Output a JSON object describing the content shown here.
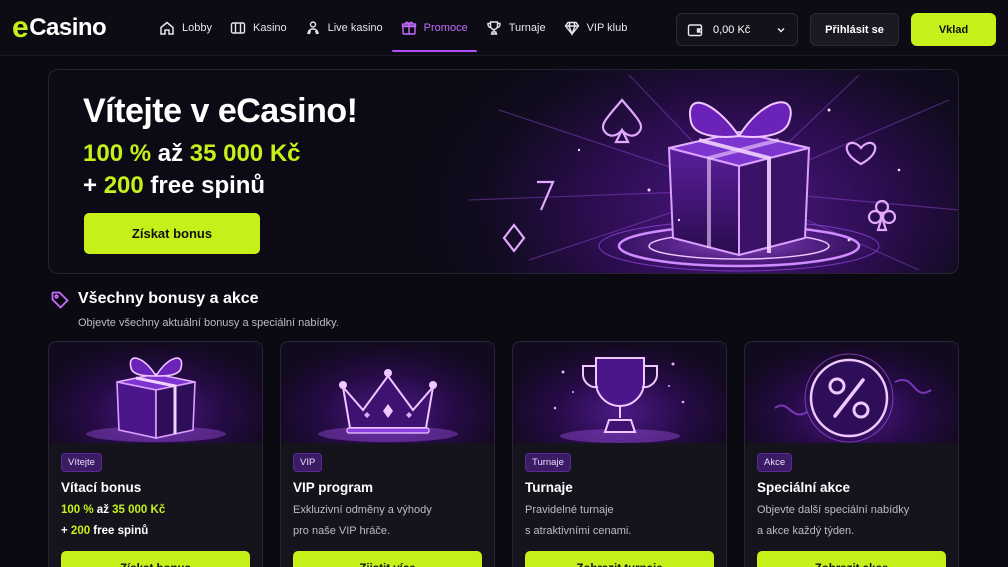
{
  "brand": {
    "e": "e",
    "rest": "Casino"
  },
  "nav": {
    "items": [
      {
        "label": "Lobby",
        "icon": "home-icon"
      },
      {
        "label": "Kasino",
        "icon": "casino-icon"
      },
      {
        "label": "Live kasino",
        "icon": "live-dealer-icon"
      },
      {
        "label": "Promoce",
        "icon": "gift-icon",
        "active": true
      },
      {
        "label": "Turnaje",
        "icon": "trophy-icon"
      },
      {
        "label": "VIP klub",
        "icon": "diamond-icon"
      }
    ]
  },
  "wallet": {
    "balance": "0,00 Kč"
  },
  "header": {
    "login_label": "Přihlásit se",
    "deposit_label": "Vklad"
  },
  "hero": {
    "title": "Vítejte v eCasino!",
    "line1": {
      "amount": "100 %",
      "mid": " až ",
      "max": "35 000 Kč"
    },
    "line2": {
      "prefix": "+ ",
      "spins": "200",
      "suffix": " free spinů"
    },
    "cta": "Získat bonus"
  },
  "section": {
    "title": "Všechny bonusy a akce",
    "subtitle": "Objevte všechny aktuální bonusy a speciální nabídky."
  },
  "cards": [
    {
      "badge": "Vítejte",
      "title": "Vítací bonus",
      "line1": {
        "amount": "100 %",
        "mid": " až ",
        "max": "35 000 Kč"
      },
      "line2": {
        "prefix": "+ ",
        "spins": "200",
        "suffix": " free spinů"
      },
      "button": "Získat bonus",
      "art": "gift-icon"
    },
    {
      "badge": "VIP",
      "title": "VIP program",
      "text1": "Exkluzivní odměny a výhody",
      "text2": "pro naše VIP hráče.",
      "button": "Zjistit více",
      "art": "crown-icon"
    },
    {
      "badge": "Turnaje",
      "title": "Turnaje",
      "text1": "Pravidelné turnaje",
      "text2": "s atraktivními cenami.",
      "button": "Zobrazit turnaje",
      "art": "trophy-icon"
    },
    {
      "badge": "Akce",
      "title": "Speciální akce",
      "text1": "Objevte další speciální nabídky",
      "text2": "a akce každý týden.",
      "button": "Zobrazit akce",
      "art": "percent-icon"
    }
  ],
  "colors": {
    "accent": "#c5f019",
    "purple": "#b44dff",
    "background": "#0b0a12"
  }
}
